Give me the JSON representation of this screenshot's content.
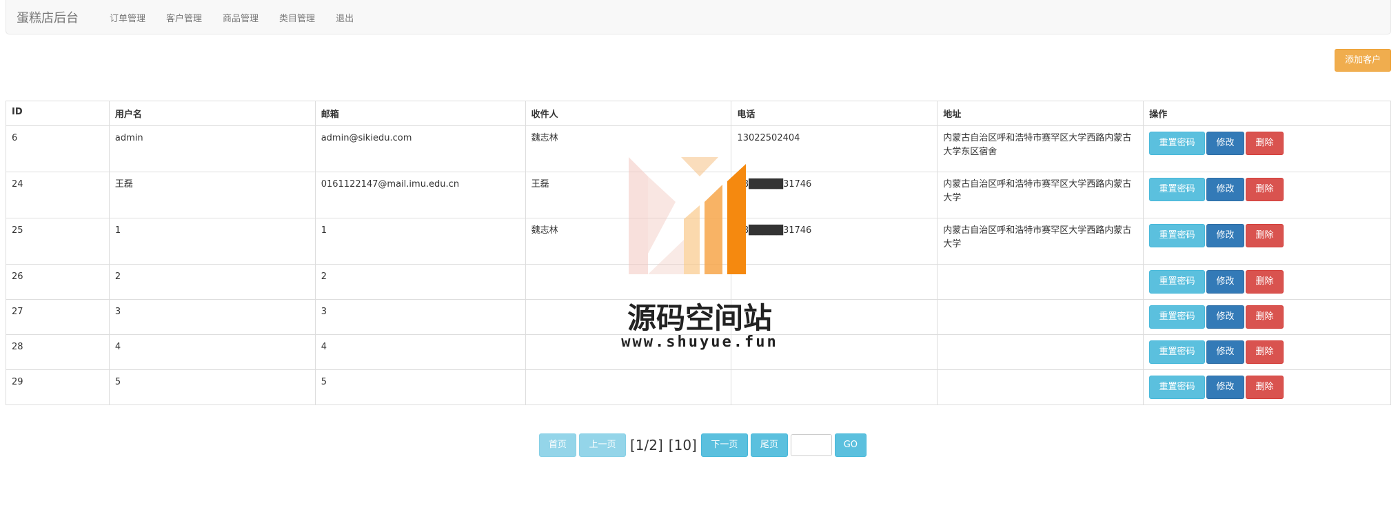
{
  "navbar": {
    "brand": "蛋糕店后台",
    "items": [
      "订单管理",
      "客户管理",
      "商品管理",
      "类目管理",
      "退出"
    ]
  },
  "toolbar": {
    "add_label": "添加客户"
  },
  "table": {
    "headers": [
      "ID",
      "用户名",
      "邮箱",
      "收件人",
      "电话",
      "地址",
      "操作"
    ],
    "rows": [
      {
        "id": "6",
        "username": "admin",
        "email": "admin@sikiedu.com",
        "recipient": "魏志林",
        "phone": "13022502404",
        "address": "内蒙古自治区呼和浩特市赛罕区大学西路内蒙古大学东区宿舍"
      },
      {
        "id": "24",
        "username": "王磊",
        "email": "0161122147@mail.imu.edu.cn",
        "recipient": "王磊",
        "phone": "18█████31746",
        "address": "内蒙古自治区呼和浩特市赛罕区大学西路内蒙古大学"
      },
      {
        "id": "25",
        "username": "1",
        "email": "1",
        "recipient": "魏志林",
        "phone": "18█████31746",
        "address": "内蒙古自治区呼和浩特市赛罕区大学西路内蒙古大学"
      },
      {
        "id": "26",
        "username": "2",
        "email": "2",
        "recipient": "",
        "phone": "",
        "address": ""
      },
      {
        "id": "27",
        "username": "3",
        "email": "3",
        "recipient": "",
        "phone": "",
        "address": ""
      },
      {
        "id": "28",
        "username": "4",
        "email": "4",
        "recipient": "",
        "phone": "",
        "address": ""
      },
      {
        "id": "29",
        "username": "5",
        "email": "5",
        "recipient": "",
        "phone": "",
        "address": ""
      }
    ],
    "actions": {
      "reset": "重置密码",
      "edit": "修改",
      "delete": "删除"
    }
  },
  "pager": {
    "first": "首页",
    "prev": "上一页",
    "page_info": "[1/2]",
    "total": "[10]",
    "next": "下一页",
    "last": "尾页",
    "go": "GO"
  },
  "watermark": {
    "title": "源码空间站",
    "url": "www.shuyue.fun"
  },
  "colors": {
    "warning": "#f0ad4e",
    "info": "#5bc0de",
    "primary": "#337ab7",
    "danger": "#d9534f",
    "watermark_orange": "#f5890f"
  }
}
